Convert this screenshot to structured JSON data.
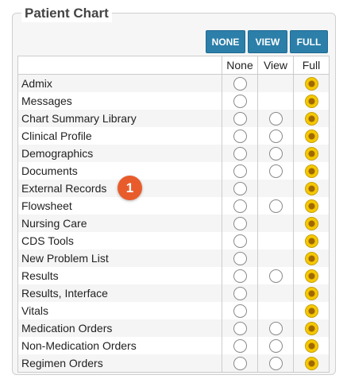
{
  "panel": {
    "title": "Patient Chart"
  },
  "buttons": {
    "none": "NONE",
    "view": "VIEW",
    "full": "FULL"
  },
  "columns": {
    "none": "None",
    "view": "View",
    "full": "Full"
  },
  "rows": [
    {
      "label": "Admix",
      "selected": "full",
      "has_view": false
    },
    {
      "label": "Messages",
      "selected": "full",
      "has_view": false
    },
    {
      "label": "Chart Summary Library",
      "selected": "full",
      "has_view": true
    },
    {
      "label": "Clinical Profile",
      "selected": "full",
      "has_view": true
    },
    {
      "label": "Demographics",
      "selected": "full",
      "has_view": true
    },
    {
      "label": "Documents",
      "selected": "full",
      "has_view": true
    },
    {
      "label": "External Records",
      "selected": "full",
      "has_view": false
    },
    {
      "label": "Flowsheet",
      "selected": "full",
      "has_view": true
    },
    {
      "label": "Nursing Care",
      "selected": "full",
      "has_view": false
    },
    {
      "label": "CDS Tools",
      "selected": "full",
      "has_view": false
    },
    {
      "label": "New Problem List",
      "selected": "full",
      "has_view": false
    },
    {
      "label": "Results",
      "selected": "full",
      "has_view": true
    },
    {
      "label": "Results, Interface",
      "selected": "full",
      "has_view": false
    },
    {
      "label": "Vitals",
      "selected": "full",
      "has_view": false
    },
    {
      "label": "Medication Orders",
      "selected": "full",
      "has_view": true
    },
    {
      "label": "Non-Medication Orders",
      "selected": "full",
      "has_view": true
    },
    {
      "label": "Regimen Orders",
      "selected": "full",
      "has_view": true
    }
  ],
  "badge": {
    "text": "1"
  },
  "colors": {
    "button_bg": "#2c7fa9",
    "badge_bg": "#e85c2c",
    "radio_checked": "#f6c900"
  }
}
